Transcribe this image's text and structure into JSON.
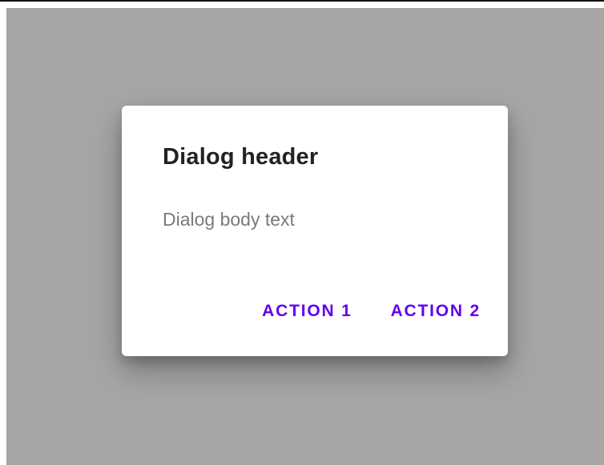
{
  "theme": {
    "accent": "#6200ee",
    "scrim": "#a6a6a6",
    "surface": "#ffffff"
  },
  "dialog": {
    "header": "Dialog header",
    "body": "Dialog body text",
    "actions": [
      {
        "label": "ACTION 1"
      },
      {
        "label": "ACTION 2"
      }
    ]
  }
}
